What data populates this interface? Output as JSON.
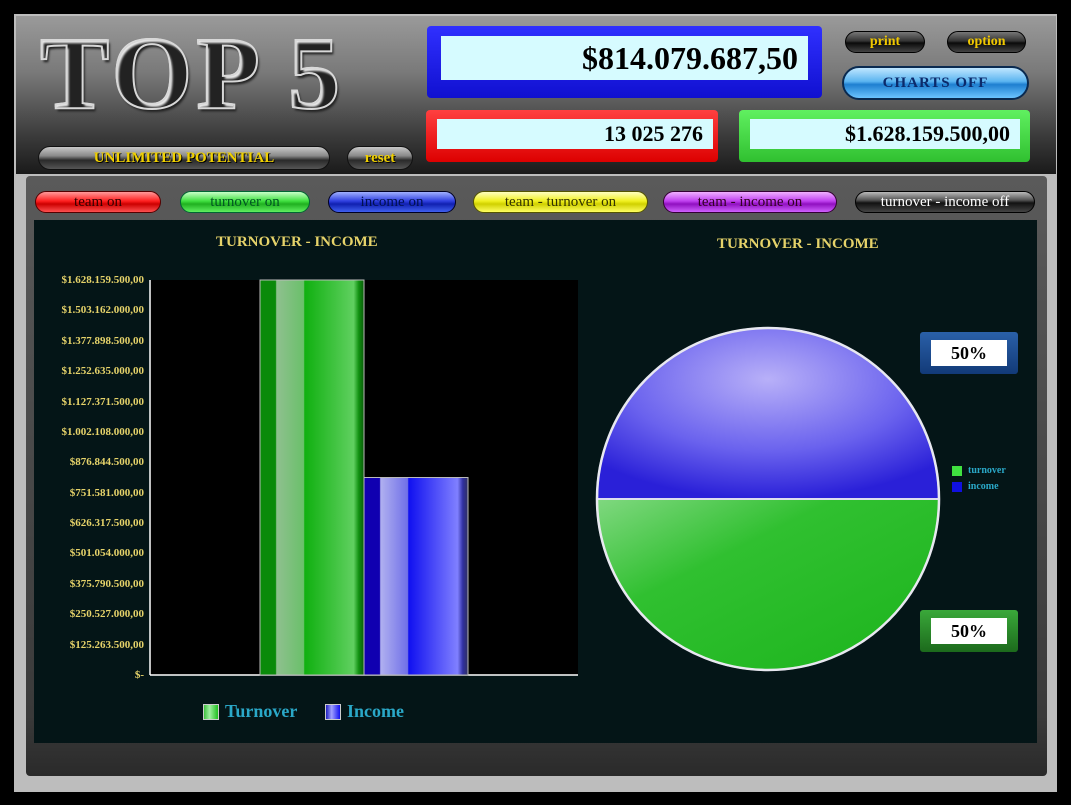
{
  "header": {
    "logo": "TOP 5",
    "tagline": "UNLIMITED POTENTIAL",
    "reset_label": "reset",
    "print_label": "print",
    "option_label": "option",
    "charts_toggle_label": "CHARTS  OFF",
    "income_total": "$814.079.687,50",
    "team_count": "13 025 276",
    "turnover_total": "$1.628.159.500,00",
    "colors": {
      "income": "#1010e0",
      "team": "#ee1010",
      "turnover": "#3ccc3c"
    }
  },
  "toggles": [
    {
      "label": "team on",
      "color": "red"
    },
    {
      "label": "turnover on",
      "color": "green"
    },
    {
      "label": "income on",
      "color": "blue"
    },
    {
      "label": "team - turnover on",
      "color": "yellow"
    },
    {
      "label": "team - income on",
      "color": "purple"
    },
    {
      "label": "turnover - income off",
      "color": "black"
    }
  ],
  "chart_data": [
    {
      "type": "bar",
      "title": "TURNOVER - INCOME",
      "categories": [
        "Turnover",
        "Income"
      ],
      "values": [
        1628159500.0,
        814079687.5
      ],
      "colors": [
        "#20c020",
        "#2020f0"
      ],
      "ylim": [
        0,
        1628159500.0
      ],
      "yticks": [
        "$1.628.159.500,00",
        "$1.503.162.000,00",
        "$1.377.898.500,00",
        "$1.252.635.000,00",
        "$1.127.371.500,00",
        "$1.002.108.000,00",
        "$876.844.500,00",
        "$751.581.000,00",
        "$626.317.500,00",
        "$501.054.000,00",
        "$375.790.500,00",
        "$250.527.000,00",
        "$125.263.500,00",
        "$-"
      ],
      "legend": [
        "Turnover",
        "Income"
      ],
      "legend_position": "bottom",
      "grid": false
    },
    {
      "type": "pie",
      "title": "TURNOVER - INCOME",
      "labels": [
        "income",
        "turnover"
      ],
      "values": [
        50,
        50
      ],
      "colors": [
        "#3a30e8",
        "#22c022"
      ],
      "data_labels": [
        "50%",
        "50%"
      ],
      "legend": [
        "turnover",
        "income"
      ],
      "legend_position": "right"
    }
  ]
}
